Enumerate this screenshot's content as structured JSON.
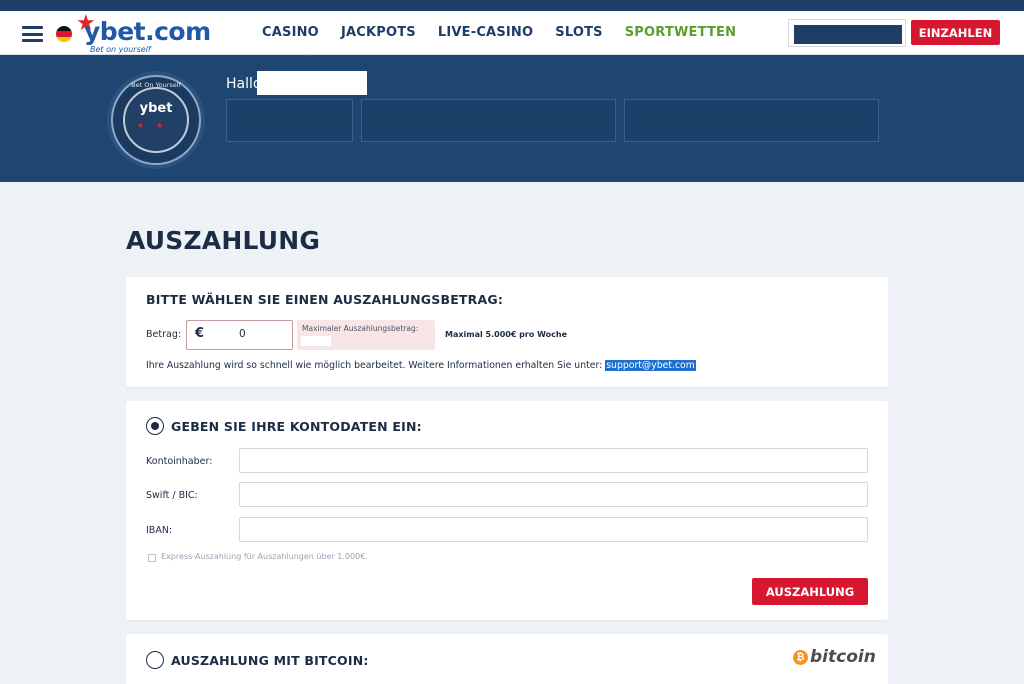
{
  "header": {
    "brand": "ybet.com",
    "tagline": "Bet on yourself",
    "nav": [
      "CASINO",
      "JACKPOTS",
      "LIVE-CASINO",
      "SLOTS",
      "SPORTWETTEN"
    ],
    "deposit_label": "EINZAHLEN"
  },
  "profile": {
    "greeting": "Hallo",
    "badge_text": "ybet",
    "badge_arc": "Bet On Yourself"
  },
  "page": {
    "title": "AUSZAHLUNG"
  },
  "amount_card": {
    "title": "BITTE WÄHLEN SIE EINEN AUSZAHLUNGSBETRAG:",
    "amount_label": "Betrag:",
    "currency": "€",
    "amount_value": "0",
    "max_label": "Maximaler Auszahlungsbetrag:",
    "weekly_limit": "Maximal 5.000€ pro Woche",
    "info_text": "Ihre Auszahlung wird so schnell wie möglich bearbeitet. Weitere Informationen erhalten Sie unter:",
    "email": "support@ybet.com"
  },
  "bank_card": {
    "title": "GEBEN SIE IHRE KONTODATEN EIN:",
    "holder_label": "Kontoinhaber:",
    "swift_label": "Swift / BIC:",
    "iban_label": "IBAN:",
    "express_label": "Express-Auszahlung für Auszahlungen über 1.000€.",
    "submit_label": "AUSZAHLUNG"
  },
  "bitcoin_card": {
    "title": "AUSZAHLUNG MIT BITCOIN:",
    "logo_text": "bitcoin",
    "logo_symbol": "₿"
  }
}
